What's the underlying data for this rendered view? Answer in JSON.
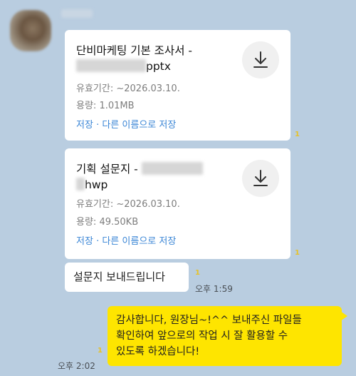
{
  "sender": {
    "name": ""
  },
  "files": [
    {
      "name_line1": "단비마케팅 기본 조사서 -",
      "name_ext": "pptx",
      "expiry_label": "유효기간:",
      "expiry_value": "~2026.03.10.",
      "size_label": "용량:",
      "size_value": "1.01MB",
      "save_label": "저장",
      "separator": "·",
      "save_as_label": "다른 이름으로 저장",
      "unread": "1"
    },
    {
      "name_line1": "기획 설문지 -",
      "name_ext": "hwp",
      "expiry_label": "유효기간:",
      "expiry_value": "~2026.03.10.",
      "size_label": "용량:",
      "size_value": "49.50KB",
      "save_label": "저장",
      "separator": "·",
      "save_as_label": "다른 이름으로 저장",
      "unread": "1"
    }
  ],
  "incoming_message": {
    "text": "설문지 보내드립니다",
    "unread": "1",
    "time": "오후 1:59"
  },
  "outgoing_message": {
    "text": "감사합니다, 원장님~!^^ 보내주신 파일들\n확인하여 앞으로의 작업 시 잘 활용할 수\n있도록 하겠습니다!",
    "unread": "1",
    "time": "오후 2:02"
  },
  "colors": {
    "background": "#b9cde0",
    "outgoing_bubble": "#fee500",
    "link": "#3b86d6",
    "unread": "#e6c22a"
  },
  "icons": {
    "download": "download-arrow-icon"
  }
}
